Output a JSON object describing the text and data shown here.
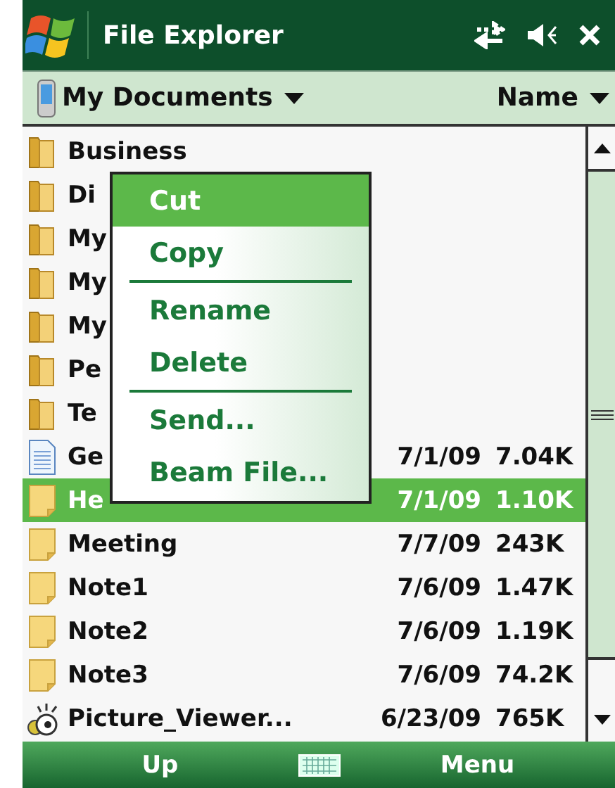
{
  "title_bar": {
    "title": "File Explorer"
  },
  "location_bar": {
    "folder": "My Documents",
    "sort": "Name"
  },
  "files": [
    {
      "kind": "folder",
      "name": "Business",
      "selected": false
    },
    {
      "kind": "folder",
      "name": "Di",
      "selected": false
    },
    {
      "kind": "folder",
      "name": "My",
      "selected": false
    },
    {
      "kind": "folder",
      "name": "My",
      "selected": false
    },
    {
      "kind": "folder",
      "name": "My",
      "selected": false
    },
    {
      "kind": "folder",
      "name": "Pe",
      "selected": false
    },
    {
      "kind": "folder",
      "name": "Te",
      "selected": false
    },
    {
      "kind": "document",
      "name": "Ge",
      "date": "7/1/09",
      "size": "7.04K",
      "selected": false
    },
    {
      "kind": "note",
      "name": "He",
      "date": "7/1/09",
      "size": "1.10K",
      "selected": true
    },
    {
      "kind": "note",
      "name": "Meeting",
      "date": "7/7/09",
      "size": "243K",
      "selected": false
    },
    {
      "kind": "note",
      "name": "Note1",
      "date": "7/6/09",
      "size": "1.47K",
      "selected": false
    },
    {
      "kind": "note",
      "name": "Note2",
      "date": "7/6/09",
      "size": "1.19K",
      "selected": false
    },
    {
      "kind": "note",
      "name": "Note3",
      "date": "7/6/09",
      "size": "74.2K",
      "selected": false
    },
    {
      "kind": "program",
      "name": "Picture_Viewer...",
      "date": "6/23/09",
      "size": "765K",
      "selected": false
    }
  ],
  "context_menu": [
    {
      "kind": "item",
      "label": "Cut",
      "selected": true
    },
    {
      "kind": "item",
      "label": "Copy",
      "selected": false
    },
    {
      "kind": "separator"
    },
    {
      "kind": "item",
      "label": "Rename",
      "selected": false
    },
    {
      "kind": "item",
      "label": "Delete",
      "selected": false
    },
    {
      "kind": "separator"
    },
    {
      "kind": "item",
      "label": "Send...",
      "selected": false
    },
    {
      "kind": "item",
      "label": "Beam File...",
      "selected": false
    }
  ],
  "soft_keys": {
    "left": "Up",
    "right": "Menu"
  }
}
